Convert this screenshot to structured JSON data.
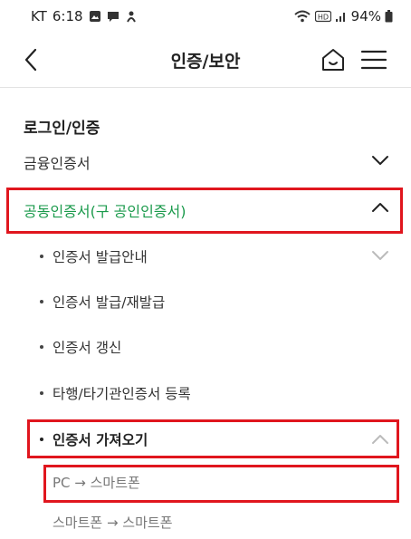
{
  "status_bar": {
    "carrier": "KT",
    "time": "6:18",
    "battery": "94%"
  },
  "header": {
    "title": "인증/보안"
  },
  "section": {
    "title": "로그인/인증"
  },
  "menu": {
    "financial_cert": "금융인증서",
    "joint_cert": "공동인증서(구 공인인증서)",
    "joint_cert_color": "#1a9a4b",
    "sub_items": [
      "인증서 발급안내",
      "인증서 발급/재발급",
      "인증서 갱신",
      "타행/타기관인증서 등록",
      "인증서 가져오기"
    ],
    "import_items": [
      "PC → 스마트폰",
      "스마트폰 → 스마트폰"
    ]
  },
  "highlight_color": "#e0161e"
}
